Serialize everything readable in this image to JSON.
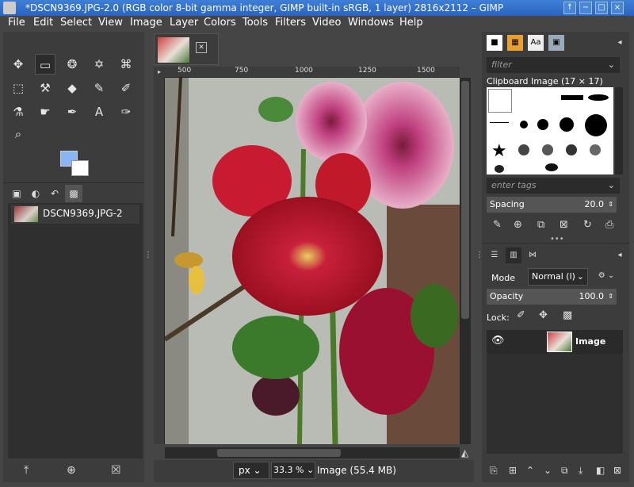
{
  "window": {
    "title": "*DSCN9369.JPG-2.0 (RGB color 8-bit gamma integer, GIMP built-in sRGB, 1 layer) 2816x2112 – GIMP",
    "controls": [
      "↑",
      "−",
      "□",
      "×"
    ]
  },
  "menu": [
    "File",
    "Edit",
    "Select",
    "View",
    "Image",
    "Layer",
    "Colors",
    "Tools",
    "Filters",
    "Video",
    "Windows",
    "Help"
  ],
  "toolbox": {
    "tools": [
      {
        "name": "move-tool",
        "glyph": "✥"
      },
      {
        "name": "rect-select-tool",
        "glyph": "▭"
      },
      {
        "name": "lasso-tool",
        "glyph": "❂"
      },
      {
        "name": "fuzzy-select-tool",
        "glyph": "✡"
      },
      {
        "name": "crop-tool",
        "glyph": "⌘"
      },
      {
        "name": "transform-tool",
        "glyph": "⬚"
      },
      {
        "name": "warp-tool",
        "glyph": "⚒"
      },
      {
        "name": "bucket-fill-tool",
        "glyph": "◆"
      },
      {
        "name": "paintbrush-tool",
        "glyph": "✎"
      },
      {
        "name": "eraser-tool",
        "glyph": "✐"
      },
      {
        "name": "clone-tool",
        "glyph": "⚗"
      },
      {
        "name": "smudge-tool",
        "glyph": "☛"
      },
      {
        "name": "paths-tool",
        "glyph": "✒"
      },
      {
        "name": "text-tool",
        "glyph": "A"
      },
      {
        "name": "color-picker-tool",
        "glyph": "✑"
      },
      {
        "name": "zoom-tool",
        "glyph": "⌕"
      }
    ],
    "fg_color": "#8ab4f8",
    "bg_color": "#ffffff",
    "image_item_label": "DSCN9369.JPG-2",
    "tab_icons": [
      "▣",
      "◐",
      "↶",
      "▩"
    ],
    "bottom_icons": [
      "⤒",
      "⊕",
      "☒"
    ]
  },
  "canvas": {
    "ruler_ticks": [
      "500",
      "750",
      "1000",
      "1250",
      "1500"
    ],
    "unit": "px",
    "zoom": "33.3 %",
    "image_size": "Image (55.4 MB)"
  },
  "brushes": {
    "filter_placeholder": "filter",
    "brush_name": "Clipboard Image (17 × 17)",
    "tags_placeholder": "enter tags",
    "spacing_label": "Spacing",
    "spacing_value": "20.0"
  },
  "layers": {
    "mode_label": "Mode",
    "mode_value": "Normal (l)",
    "opacity_label": "Opacity",
    "opacity_value": "100.0",
    "lock_label": "Lock:",
    "layer_name": "Image"
  }
}
